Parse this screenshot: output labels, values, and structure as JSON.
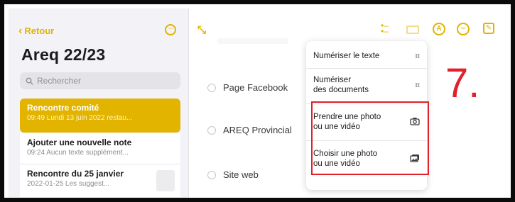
{
  "sidebar": {
    "back_label": "Retour",
    "folder_title": "Areq 22/23",
    "search_placeholder": "Rechercher",
    "notes": [
      {
        "title": "Rencontre comité",
        "subtitle": "09:49  Lundi 13 juin 2022 restau..."
      },
      {
        "title": "Ajouter une nouvelle note",
        "subtitle": "09:24  Aucun texte supplément..."
      },
      {
        "title": "Rencontre du 25 janvier",
        "subtitle": "2022-01-25  Les suggest..."
      }
    ]
  },
  "note_content": {
    "items": [
      "Page Facebook",
      "AREQ Provincial",
      "Site web"
    ]
  },
  "menu": {
    "items": [
      {
        "label": "Numériser le texte",
        "icon": "scan-text-icon"
      },
      {
        "label_line1": "Numériser",
        "label_line2": "des documents",
        "icon": "scan-document-icon"
      },
      {
        "label_line1": "Prendre une photo",
        "label_line2": "ou une vidéo",
        "icon": "camera-icon"
      },
      {
        "label_line1": "Choisir une photo",
        "label_line2": "ou une vidéo",
        "icon": "photo-library-icon"
      }
    ]
  },
  "annotation": {
    "step": "7."
  },
  "colors": {
    "accent": "#e2b400",
    "highlight": "#e0202a",
    "selected_note": "#e2b400"
  }
}
